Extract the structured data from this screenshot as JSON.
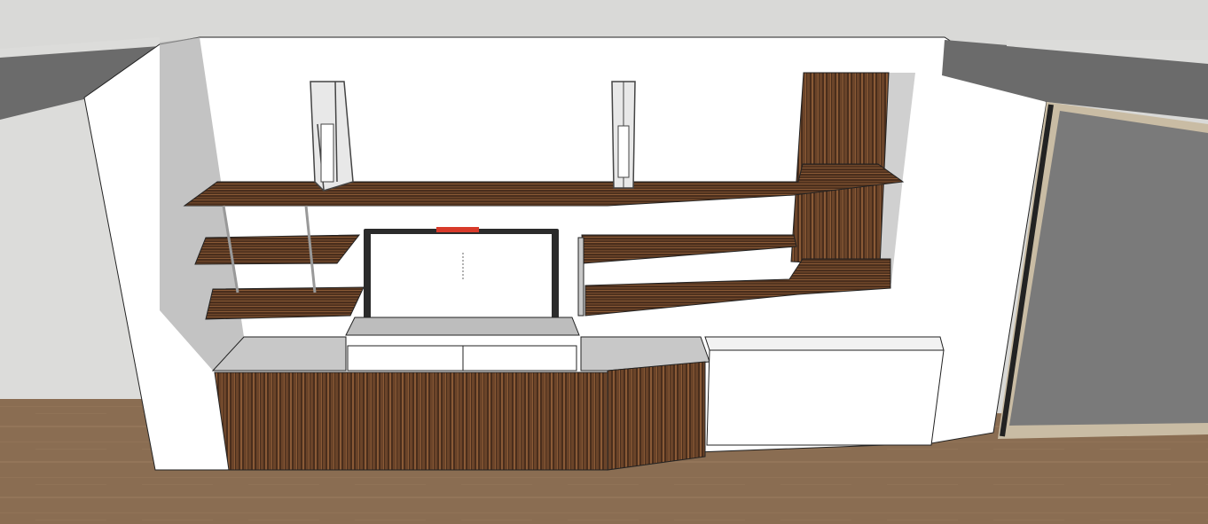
{
  "scene": {
    "kind": "3d-model-viewport",
    "subject": "wall-unit",
    "has_text": false
  },
  "colors": {
    "sky": "#d9d9d7",
    "wall": "#ffffff",
    "wall_shadow": "#a9a9a9",
    "side_wall": "#dcdcda",
    "beam": "#6b6b6b",
    "wood_dark": "#4a2e1c",
    "wood_mid": "#6b4429",
    "wood_light": "#8a5a36",
    "floor": "#8a6d52",
    "floor_light": "#9b7d60",
    "outline": "#222222",
    "cabinet_top": "#c8c8c8",
    "tv_frame": "#2b2b2b",
    "tv_screen": "#ffffff",
    "tv_stand": "#bdbdbd",
    "indicator": "#d83a2a",
    "door_panel": "#7a7a7a",
    "door_frame": "#c9bca4",
    "metal": "#e8e8e8"
  },
  "items": {
    "shelves": 6,
    "lamps": 2,
    "tv": 1,
    "drawers": 2
  }
}
